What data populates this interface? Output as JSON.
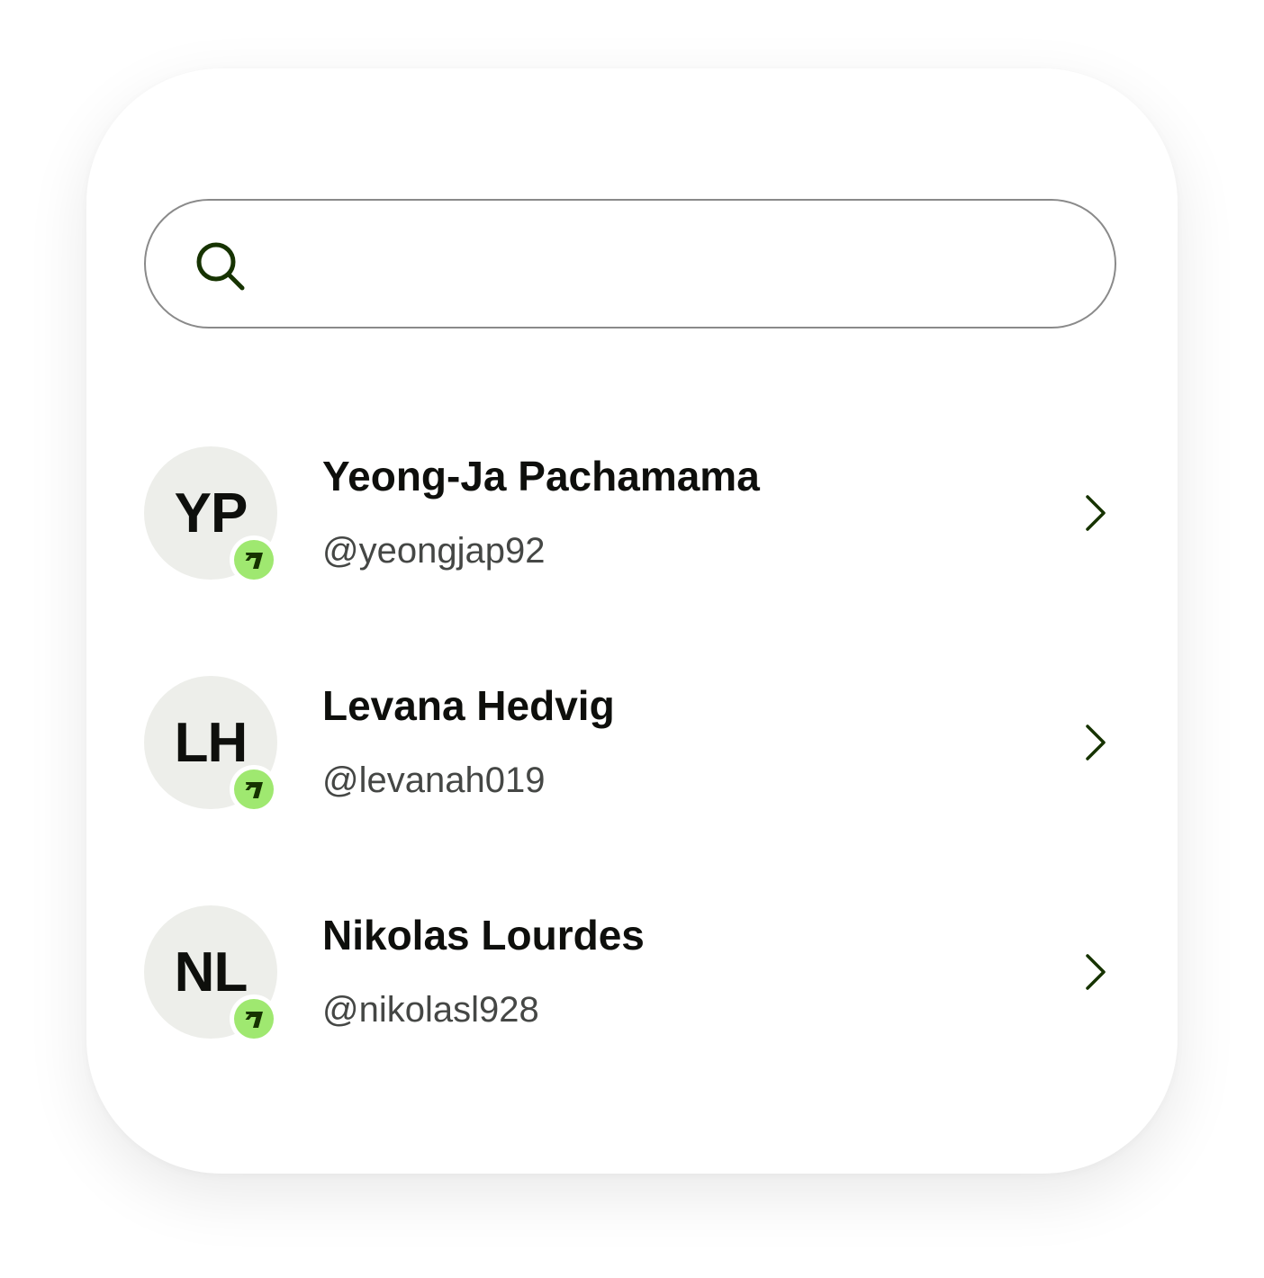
{
  "search": {
    "placeholder": "",
    "value": "",
    "icon": "search-icon"
  },
  "contacts": [
    {
      "initials": "YP",
      "name": "Yeong-Ja Pachamama",
      "handle": "@yeongjap92",
      "badge_icon": "wise-flag-icon",
      "chevron_icon": "chevron-right-icon"
    },
    {
      "initials": "LH",
      "name": "Levana Hedvig",
      "handle": "@levanah019",
      "badge_icon": "wise-flag-icon",
      "chevron_icon": "chevron-right-icon"
    },
    {
      "initials": "NL",
      "name": "Nikolas Lourdes",
      "handle": "@nikolasl928",
      "badge_icon": "wise-flag-icon",
      "chevron_icon": "chevron-right-icon"
    }
  ],
  "colors": {
    "accent": "#9fe870",
    "icon_dark": "#163300",
    "avatar_bg": "#edeeea",
    "text_primary": "#0e0f0c",
    "text_secondary": "#454745",
    "search_border": "#8a8a8a"
  }
}
